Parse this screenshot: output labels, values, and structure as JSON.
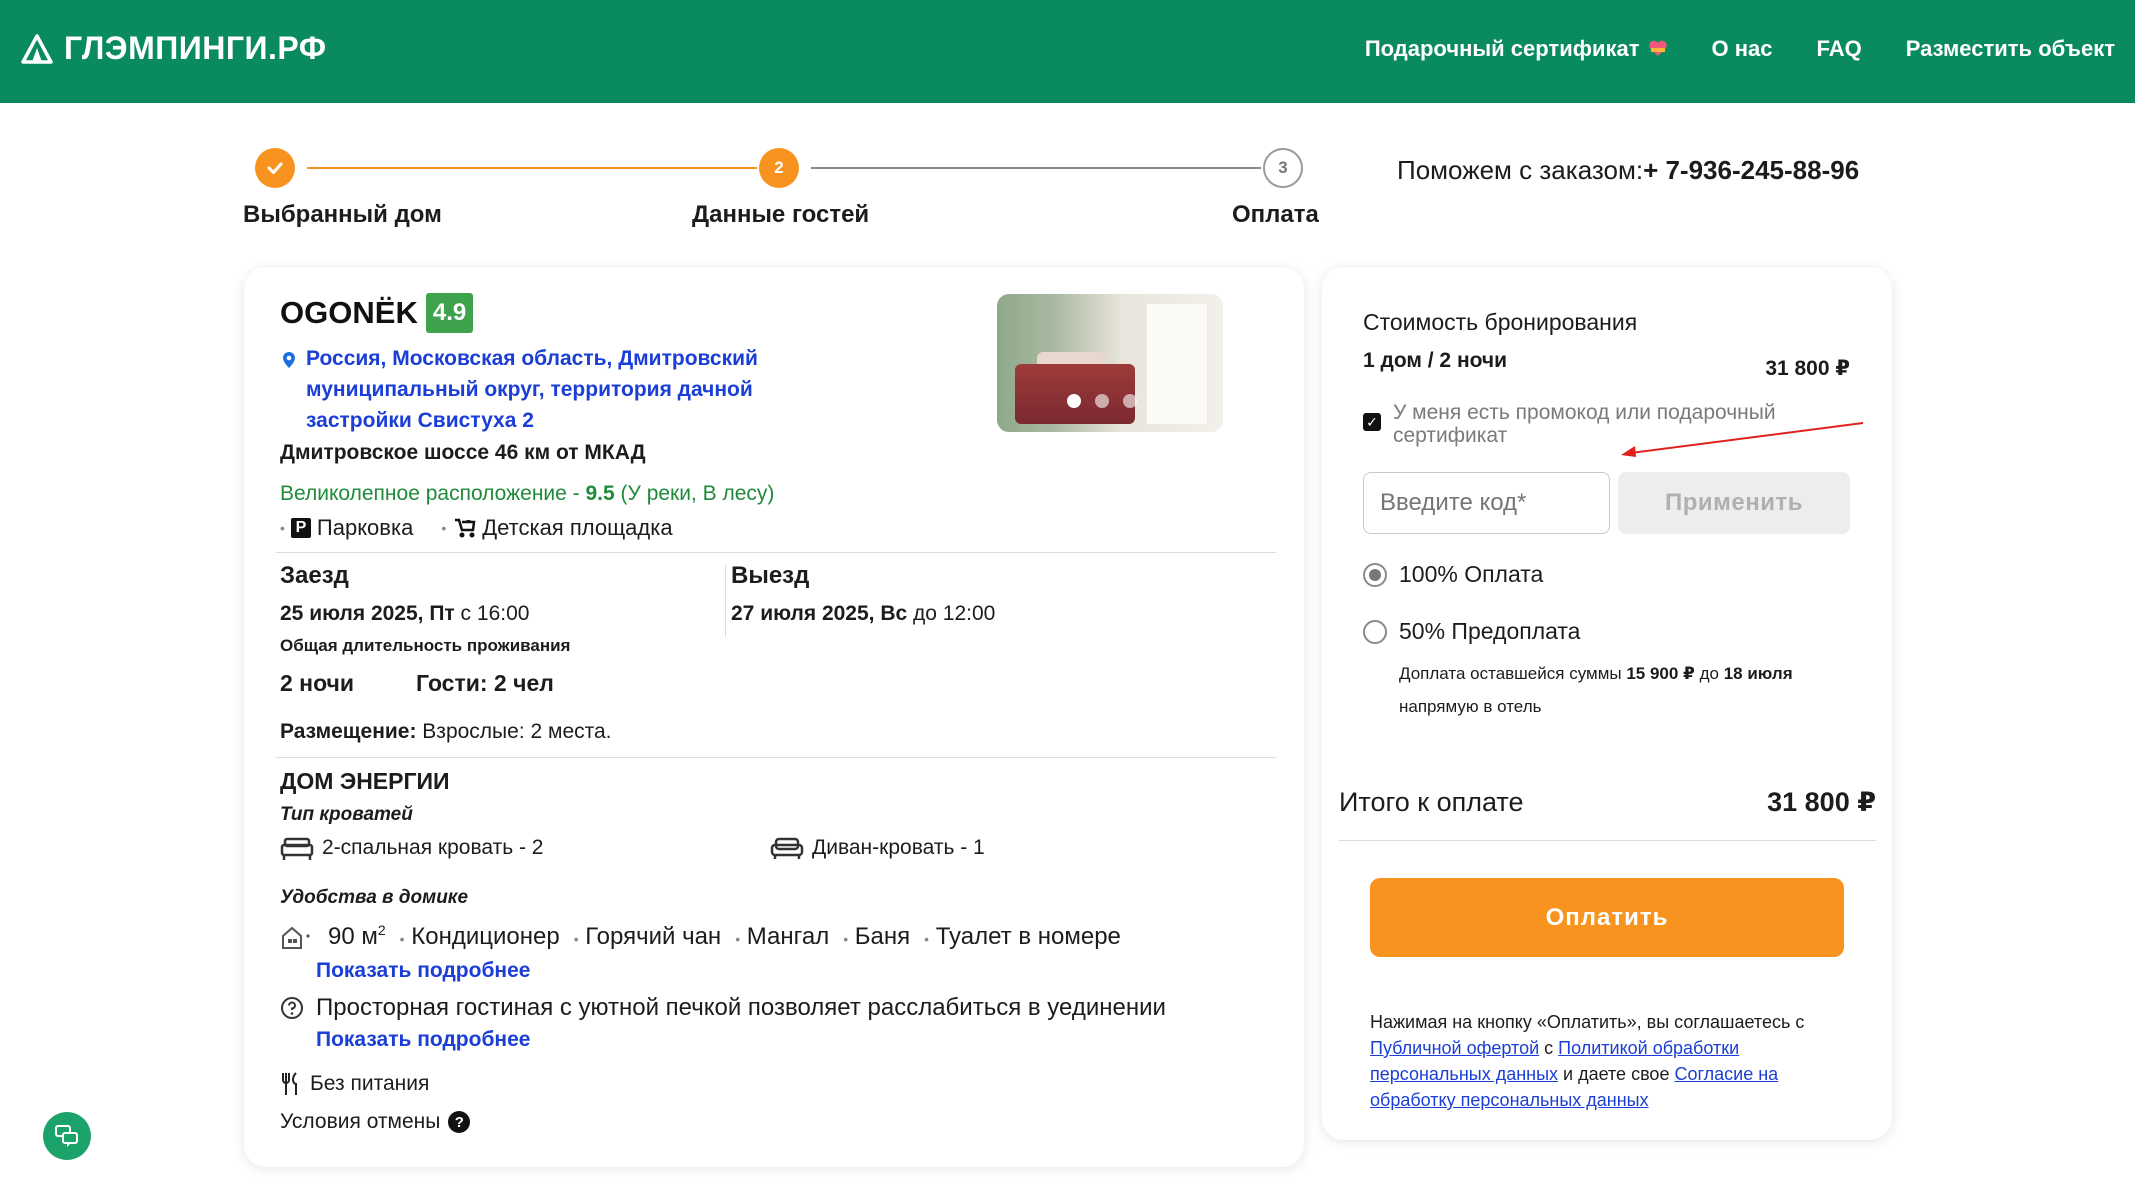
{
  "header": {
    "logo_text": "ГЛЭМПИНГИ.РФ",
    "nav": [
      {
        "label": "Подарочный сертификат"
      },
      {
        "label": "О нас"
      },
      {
        "label": "FAQ"
      },
      {
        "label": "Разместить объект"
      }
    ]
  },
  "stepper": {
    "steps": [
      {
        "label": "Выбранный дом",
        "state": "done"
      },
      {
        "label": "Данные гостей",
        "number": "2",
        "state": "active"
      },
      {
        "label": "Оплата",
        "number": "3",
        "state": "todo"
      }
    ]
  },
  "help": {
    "text": "Поможем с заказом:",
    "phone": "+ 7-936-245-88-96"
  },
  "hotel": {
    "name": "OGONЁK",
    "rating": "4.9",
    "address": "Россия, Московская область, Дмитровский муниципальный округ, территория дачной застройки Свистуха 2",
    "road": "Дмитровское шоссе 46 км от МКАД",
    "location_prefix": "Великолепное расположение - ",
    "location_score": "9.5",
    "location_suffix": " (У реки, В лесу)",
    "amenities": [
      {
        "label": "Парковка",
        "icon": "parking-icon"
      },
      {
        "label": "Детская площадка",
        "icon": "stroller-icon"
      }
    ]
  },
  "stay": {
    "checkin_label": "Заезд",
    "checkin_date": "25 июля 2025, Пт",
    "checkin_time": " с 16:00",
    "checkout_label": "Выезд",
    "checkout_date": "27 июля 2025, Вс",
    "checkout_time": " до 12:00",
    "duration_label": "Общая длительность проживания",
    "nights": "2 ночи",
    "guests": "Гости: 2 чел",
    "placement_label": "Размещение:",
    "placement_value": " Взрослые: 2 места."
  },
  "room": {
    "name": "ДОМ ЭНЕРГИИ",
    "bed_types_label": "Тип кроватей",
    "beds": [
      {
        "label": "2-спальная кровать - 2",
        "icon": "bed-icon"
      },
      {
        "label": "Диван-кровать - 1",
        "icon": "sofa-icon"
      }
    ],
    "facilities_label": "Удобства в домике",
    "area": "90 м",
    "area_sup": "2",
    "features": [
      "Кондиционер",
      "Горячий чан",
      "Мангал",
      "Баня",
      "Туалет в номере"
    ],
    "more_label": "Показать подробнее",
    "description": "Просторная гостиная с уютной печкой позволяет расслабиться в уединении",
    "meal": "Без питания",
    "cancel": "Условия отмены"
  },
  "booking": {
    "title": "Стоимость бронирования",
    "summary": "1 дом / 2 ночи",
    "price": "31 800 ₽",
    "promo_label": "У меня есть промокод или подарочный сертификат",
    "promo_checked": true,
    "code_placeholder": "Введите код*",
    "apply_label": "Применить",
    "options": [
      {
        "label": "100% Оплата",
        "selected": true
      },
      {
        "label": "50% Предоплата",
        "selected": false
      }
    ],
    "rest_prefix": "Доплата оставшейся суммы ",
    "rest_amount": "15 900 ₽",
    "rest_mid": " до ",
    "rest_date": "18 июля",
    "rest_suffix": " напрямую в отель",
    "total_label": "Итого к оплате",
    "total_value": "31 800 ₽",
    "pay_label": "Оплатить",
    "legal": {
      "t1": "Нажимая на кнопку «Оплатить», вы соглашаетесь с ",
      "link1": "Публичной офертой",
      "t2": " с ",
      "link2": "Политикой обработки персональных данных",
      "t3": " и даете свое ",
      "link3": "Согласие на обработку персональных данных"
    }
  },
  "colors": {
    "brand": "#0a8a5f",
    "accent": "#f7931e",
    "link": "#1a3ed6",
    "rating": "#3fa34d"
  }
}
